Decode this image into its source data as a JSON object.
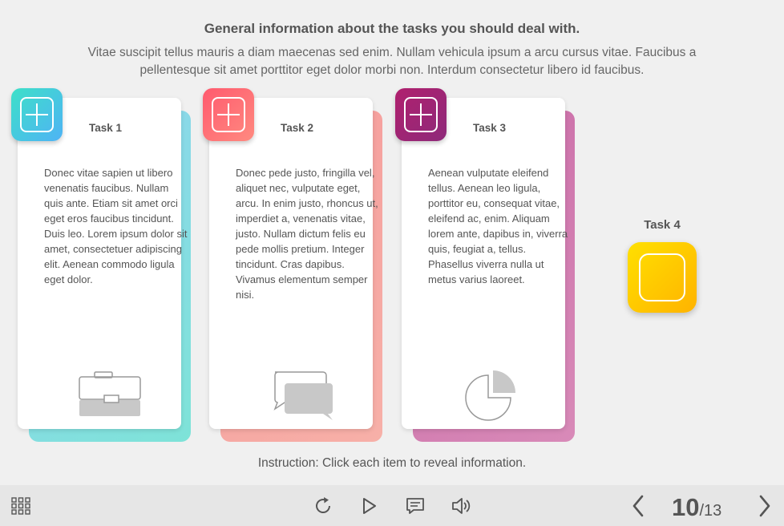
{
  "header": {
    "title": "General information about the tasks you should deal with.",
    "description": "Vitae suscipit tellus mauris a diam maecenas sed enim. Nullam vehicula ipsum a arcu cursus vitae. Faucibus a pellentesque sit amet porttitor eget dolor morbi non. Interdum consectetur libero id faucibus."
  },
  "tasks": [
    {
      "title": "Task 1",
      "text": "Donec vitae sapien ut libero venenatis faucibus. Nullam quis ante. Etiam sit amet orci eget eros faucibus tincidunt. Duis leo. Lorem ipsum dolor sit amet, consectetuer adipiscing elit. Aenean commodo ligula eget dolor.",
      "icon": "briefcase-icon",
      "badge_colors": [
        "#3de0c8",
        "#4fb3f5"
      ],
      "shadow_colors": [
        "#8fd4ef",
        "#7ee3d8"
      ]
    },
    {
      "title": "Task 2",
      "text": "Donec pede justo, fringilla vel, aliquet nec, vulputate eget, arcu. In enim justo, rhoncus ut, imperdiet a, venenatis vitae, justo. Nullam dictum felis eu pede mollis pretium. Integer tincidunt. Cras dapibus. Vivamus elementum semper nisi.",
      "icon": "chat-bubbles-icon",
      "badge_colors": [
        "#ff5a6e",
        "#ff8a80"
      ],
      "shadow_colors": [
        "#f59a9a",
        "#f7b0a8"
      ]
    },
    {
      "title": "Task 3",
      "text": "Aenean vulputate eleifend tellus. Aenean leo ligula, porttitor eu, consequat vitae, eleifend ac, enim. Aliquam lorem ante, dapibus in, viverra quis, feugiat a, tellus. Phasellus viverra nulla ut metus varius laoreet.",
      "icon": "pie-chart-icon",
      "badge_colors": [
        "#b0206e",
        "#8e2a7a"
      ],
      "shadow_colors": [
        "#c96aa6",
        "#d88ab8"
      ]
    }
  ],
  "task4": {
    "title": "Task 4",
    "badge_colors": [
      "#ffe000",
      "#ffb300"
    ]
  },
  "instruction": "Instruction: Click each item to reveal information.",
  "bottom_bar": {
    "icons": [
      "menu-grid-icon",
      "replay-icon",
      "play-icon",
      "captions-icon",
      "volume-icon",
      "prev-icon",
      "next-icon"
    ],
    "page_current": "10",
    "page_total": "/13"
  }
}
